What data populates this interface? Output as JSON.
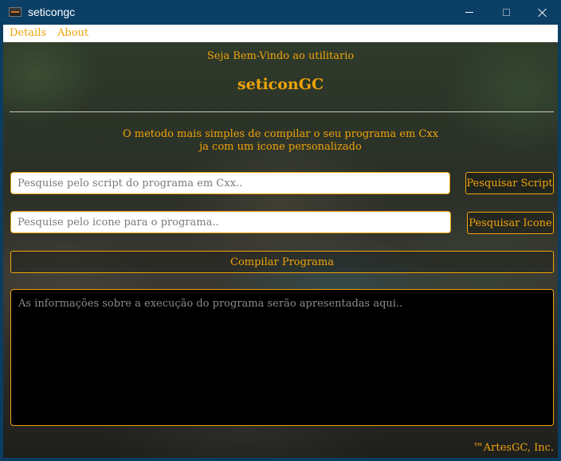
{
  "window": {
    "title": "seticongc",
    "icon": "app-icon"
  },
  "menu": {
    "details": "Details",
    "about": "About"
  },
  "header": {
    "welcome": "Seja Bem-Vindo ao utilitario",
    "app_name": "seticonGC"
  },
  "tagline": {
    "line1": "O metodo mais simples de compilar o seu programa em Cxx",
    "line2": "ja com um icone personalizado"
  },
  "script_search": {
    "placeholder": "Pesquise pelo script do programa em Cxx..",
    "value": "",
    "button": "Pesquisar Script"
  },
  "icon_search": {
    "placeholder": "Pesquise pelo icone para o programa..",
    "value": "",
    "button": "Pesquisar Icone"
  },
  "compile": {
    "button": "Compilar Programa"
  },
  "output": {
    "placeholder": "As informações sobre a execução do programa serão apresentadas aqui.."
  },
  "footer": {
    "copyright": "™ArtesGC, Inc."
  },
  "colors": {
    "accent": "#f0a30a",
    "titlebar": "#0b3f66",
    "output_bg": "#000000"
  }
}
